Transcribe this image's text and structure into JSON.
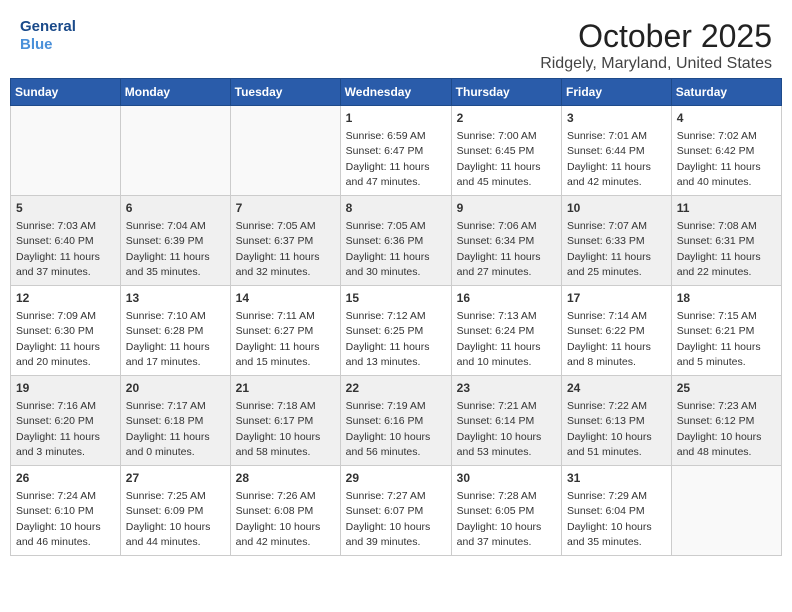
{
  "header": {
    "logo_line1": "General",
    "logo_line2": "Blue",
    "month": "October 2025",
    "location": "Ridgely, Maryland, United States"
  },
  "days_of_week": [
    "Sunday",
    "Monday",
    "Tuesday",
    "Wednesday",
    "Thursday",
    "Friday",
    "Saturday"
  ],
  "weeks": [
    [
      {
        "day": "",
        "info": "",
        "empty": true
      },
      {
        "day": "",
        "info": "",
        "empty": true
      },
      {
        "day": "",
        "info": "",
        "empty": true
      },
      {
        "day": "1",
        "info": "Sunrise: 6:59 AM\nSunset: 6:47 PM\nDaylight: 11 hours\nand 47 minutes."
      },
      {
        "day": "2",
        "info": "Sunrise: 7:00 AM\nSunset: 6:45 PM\nDaylight: 11 hours\nand 45 minutes."
      },
      {
        "day": "3",
        "info": "Sunrise: 7:01 AM\nSunset: 6:44 PM\nDaylight: 11 hours\nand 42 minutes."
      },
      {
        "day": "4",
        "info": "Sunrise: 7:02 AM\nSunset: 6:42 PM\nDaylight: 11 hours\nand 40 minutes."
      }
    ],
    [
      {
        "day": "5",
        "info": "Sunrise: 7:03 AM\nSunset: 6:40 PM\nDaylight: 11 hours\nand 37 minutes."
      },
      {
        "day": "6",
        "info": "Sunrise: 7:04 AM\nSunset: 6:39 PM\nDaylight: 11 hours\nand 35 minutes."
      },
      {
        "day": "7",
        "info": "Sunrise: 7:05 AM\nSunset: 6:37 PM\nDaylight: 11 hours\nand 32 minutes."
      },
      {
        "day": "8",
        "info": "Sunrise: 7:05 AM\nSunset: 6:36 PM\nDaylight: 11 hours\nand 30 minutes."
      },
      {
        "day": "9",
        "info": "Sunrise: 7:06 AM\nSunset: 6:34 PM\nDaylight: 11 hours\nand 27 minutes."
      },
      {
        "day": "10",
        "info": "Sunrise: 7:07 AM\nSunset: 6:33 PM\nDaylight: 11 hours\nand 25 minutes."
      },
      {
        "day": "11",
        "info": "Sunrise: 7:08 AM\nSunset: 6:31 PM\nDaylight: 11 hours\nand 22 minutes."
      }
    ],
    [
      {
        "day": "12",
        "info": "Sunrise: 7:09 AM\nSunset: 6:30 PM\nDaylight: 11 hours\nand 20 minutes."
      },
      {
        "day": "13",
        "info": "Sunrise: 7:10 AM\nSunset: 6:28 PM\nDaylight: 11 hours\nand 17 minutes."
      },
      {
        "day": "14",
        "info": "Sunrise: 7:11 AM\nSunset: 6:27 PM\nDaylight: 11 hours\nand 15 minutes."
      },
      {
        "day": "15",
        "info": "Sunrise: 7:12 AM\nSunset: 6:25 PM\nDaylight: 11 hours\nand 13 minutes."
      },
      {
        "day": "16",
        "info": "Sunrise: 7:13 AM\nSunset: 6:24 PM\nDaylight: 11 hours\nand 10 minutes."
      },
      {
        "day": "17",
        "info": "Sunrise: 7:14 AM\nSunset: 6:22 PM\nDaylight: 11 hours\nand 8 minutes."
      },
      {
        "day": "18",
        "info": "Sunrise: 7:15 AM\nSunset: 6:21 PM\nDaylight: 11 hours\nand 5 minutes."
      }
    ],
    [
      {
        "day": "19",
        "info": "Sunrise: 7:16 AM\nSunset: 6:20 PM\nDaylight: 11 hours\nand 3 minutes."
      },
      {
        "day": "20",
        "info": "Sunrise: 7:17 AM\nSunset: 6:18 PM\nDaylight: 11 hours\nand 0 minutes."
      },
      {
        "day": "21",
        "info": "Sunrise: 7:18 AM\nSunset: 6:17 PM\nDaylight: 10 hours\nand 58 minutes."
      },
      {
        "day": "22",
        "info": "Sunrise: 7:19 AM\nSunset: 6:16 PM\nDaylight: 10 hours\nand 56 minutes."
      },
      {
        "day": "23",
        "info": "Sunrise: 7:21 AM\nSunset: 6:14 PM\nDaylight: 10 hours\nand 53 minutes."
      },
      {
        "day": "24",
        "info": "Sunrise: 7:22 AM\nSunset: 6:13 PM\nDaylight: 10 hours\nand 51 minutes."
      },
      {
        "day": "25",
        "info": "Sunrise: 7:23 AM\nSunset: 6:12 PM\nDaylight: 10 hours\nand 48 minutes."
      }
    ],
    [
      {
        "day": "26",
        "info": "Sunrise: 7:24 AM\nSunset: 6:10 PM\nDaylight: 10 hours\nand 46 minutes."
      },
      {
        "day": "27",
        "info": "Sunrise: 7:25 AM\nSunset: 6:09 PM\nDaylight: 10 hours\nand 44 minutes."
      },
      {
        "day": "28",
        "info": "Sunrise: 7:26 AM\nSunset: 6:08 PM\nDaylight: 10 hours\nand 42 minutes."
      },
      {
        "day": "29",
        "info": "Sunrise: 7:27 AM\nSunset: 6:07 PM\nDaylight: 10 hours\nand 39 minutes."
      },
      {
        "day": "30",
        "info": "Sunrise: 7:28 AM\nSunset: 6:05 PM\nDaylight: 10 hours\nand 37 minutes."
      },
      {
        "day": "31",
        "info": "Sunrise: 7:29 AM\nSunset: 6:04 PM\nDaylight: 10 hours\nand 35 minutes."
      },
      {
        "day": "",
        "info": "",
        "empty": true
      }
    ]
  ]
}
